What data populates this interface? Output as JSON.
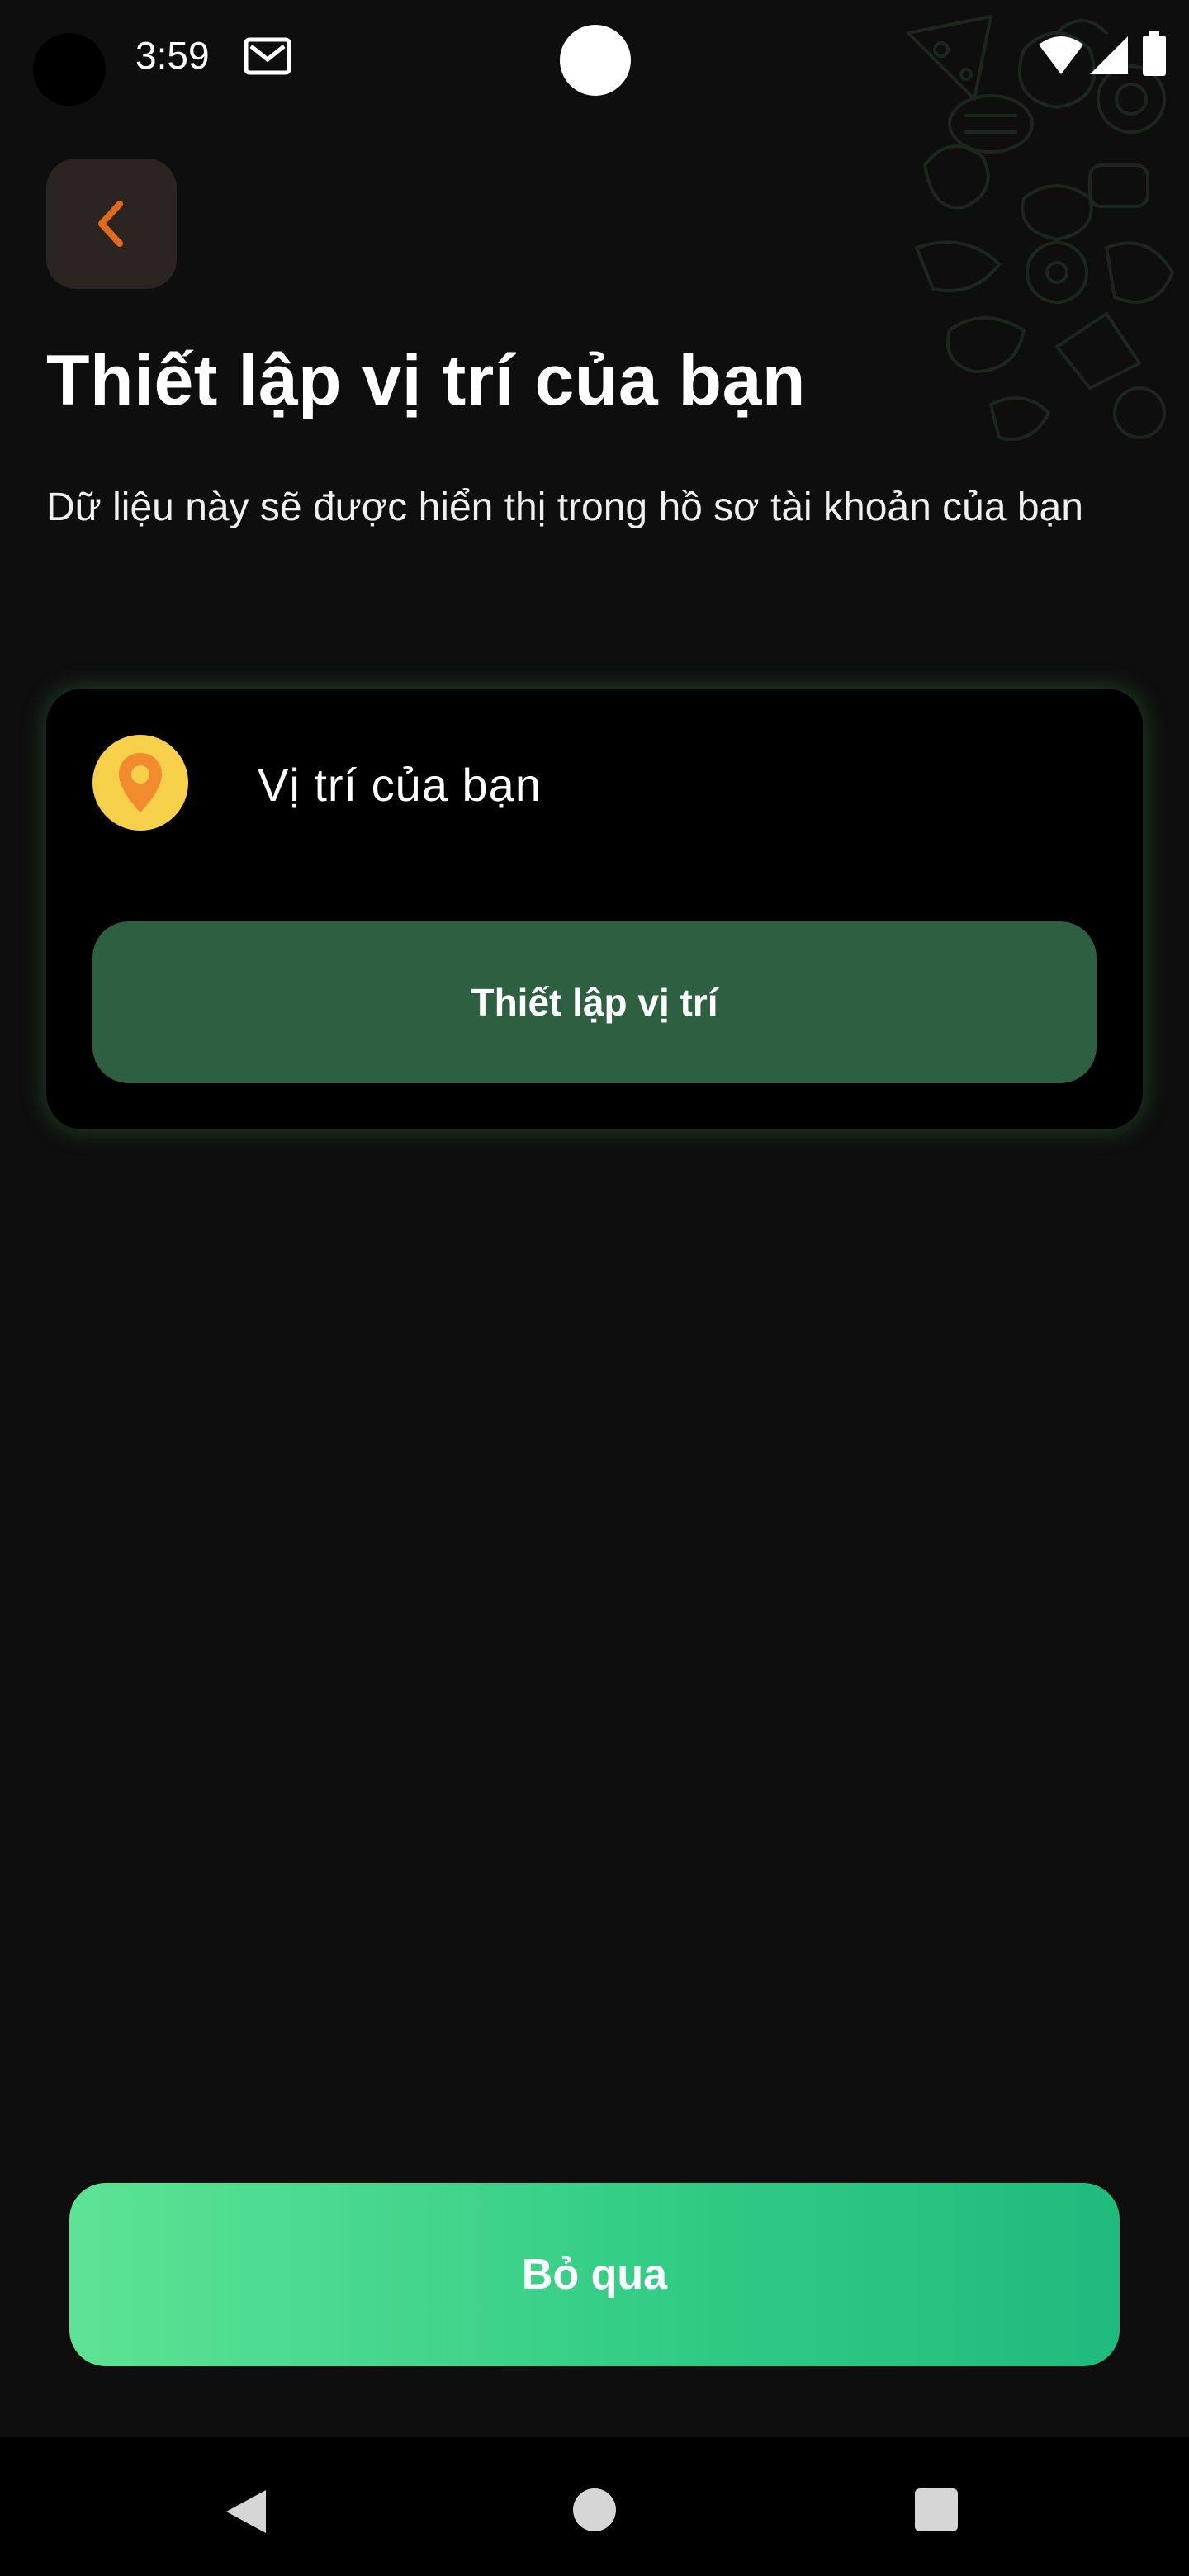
{
  "status_bar": {
    "time": "3:59"
  },
  "header": {
    "title": "Thiết lập vị trí của bạn",
    "subtitle": "Dữ liệu này sẽ được hiển thị trong hồ sơ tài khoản của bạn"
  },
  "location_card": {
    "label": "Vị trí của bạn",
    "button_label": "Thiết lập vị trí"
  },
  "footer": {
    "skip_label": "Bỏ qua"
  },
  "icons": {
    "back": "chevron-left-icon",
    "pin": "location-pin-icon",
    "mail": "gmail-icon",
    "wifi": "wifi-icon",
    "signal": "cell-signal-icon",
    "battery": "battery-icon"
  },
  "colors": {
    "background": "#0e0e0e",
    "accent_orange": "#e06a1e",
    "card_button": "#2c6040",
    "skip_gradient_start": "#5de394",
    "skip_gradient_end": "#1fbb7d",
    "pin_badge": "#f7d04a"
  }
}
